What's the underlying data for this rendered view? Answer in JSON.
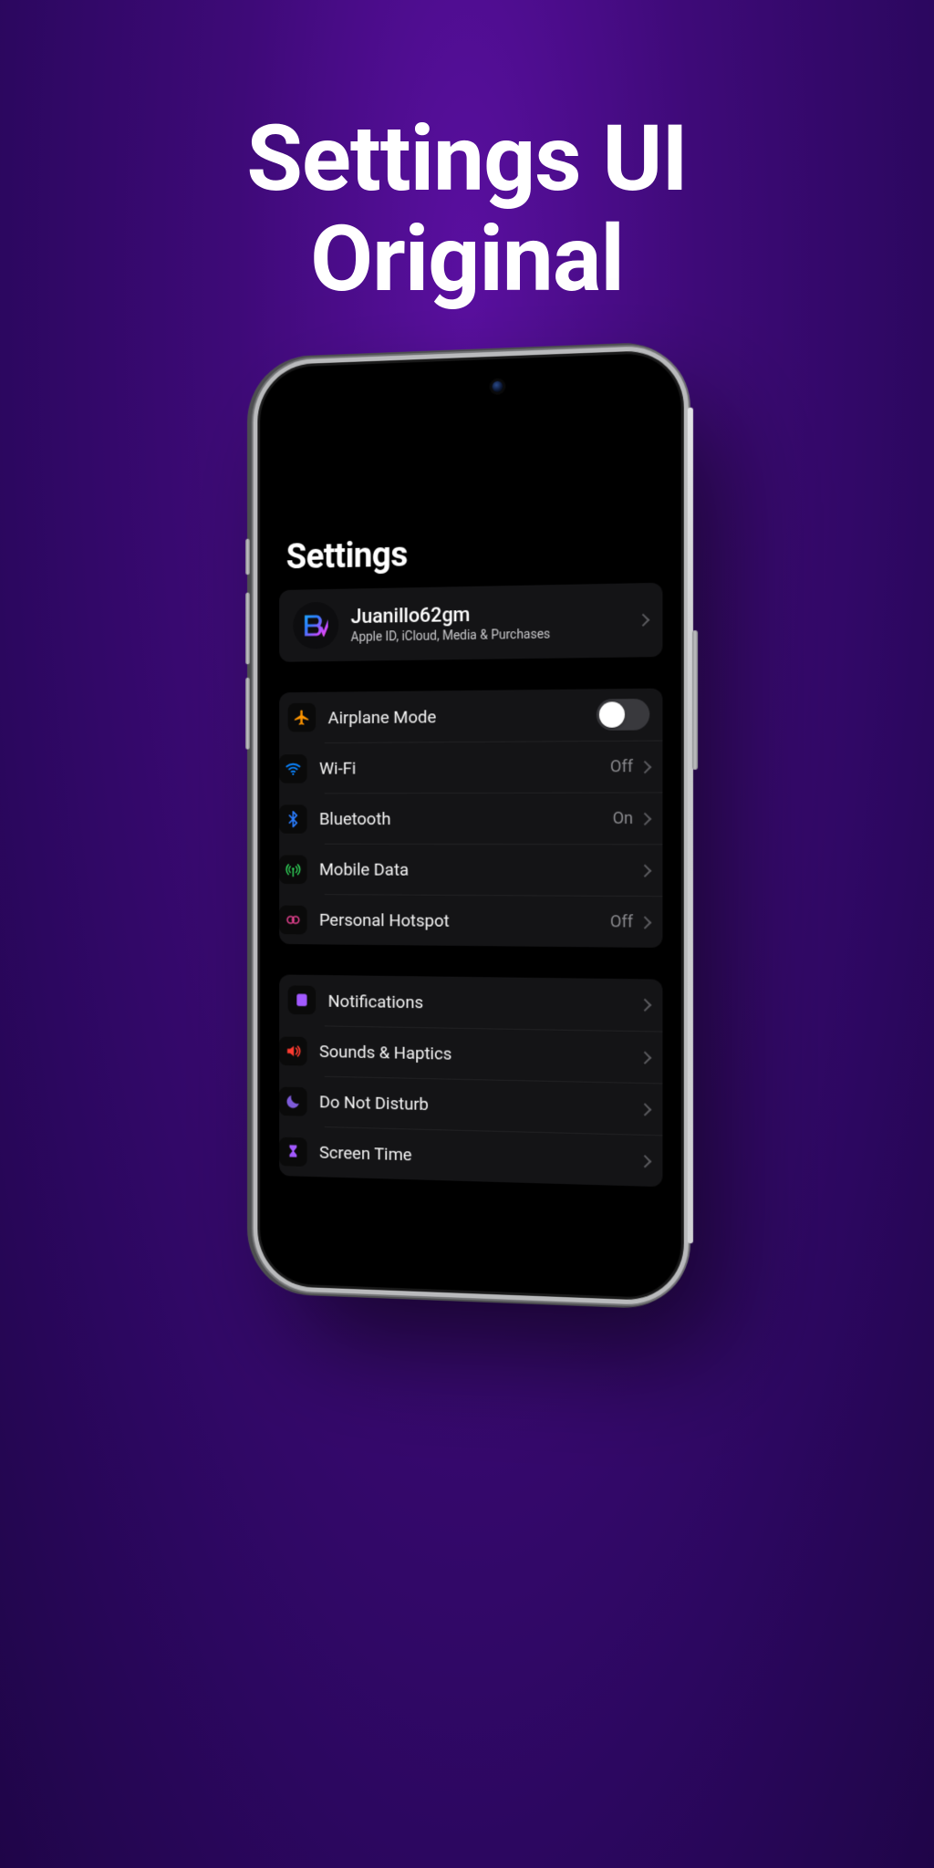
{
  "promo": {
    "line1": "Settings UI",
    "line2": "Original"
  },
  "pageTitle": "Settings",
  "profile": {
    "name": "Juanillo62gm",
    "subtitle": "Apple ID, iCloud, Media & Purchases",
    "avatarGlyph": "ᗷꤶ"
  },
  "group1": [
    {
      "label": "Airplane Mode",
      "icon": "airplane",
      "toggle": false
    },
    {
      "label": "Wi-Fi",
      "icon": "wifi",
      "value": "Off"
    },
    {
      "label": "Bluetooth",
      "icon": "bluetooth",
      "value": "On"
    },
    {
      "label": "Mobile Data",
      "icon": "antenna"
    },
    {
      "label": "Personal Hotspot",
      "icon": "hotspot",
      "value": "Off"
    }
  ],
  "group2": [
    {
      "label": "Notifications",
      "icon": "notifications"
    },
    {
      "label": "Sounds & Haptics",
      "icon": "sounds"
    },
    {
      "label": "Do Not Disturb",
      "icon": "dnd"
    },
    {
      "label": "Screen Time",
      "icon": "screentime"
    }
  ]
}
